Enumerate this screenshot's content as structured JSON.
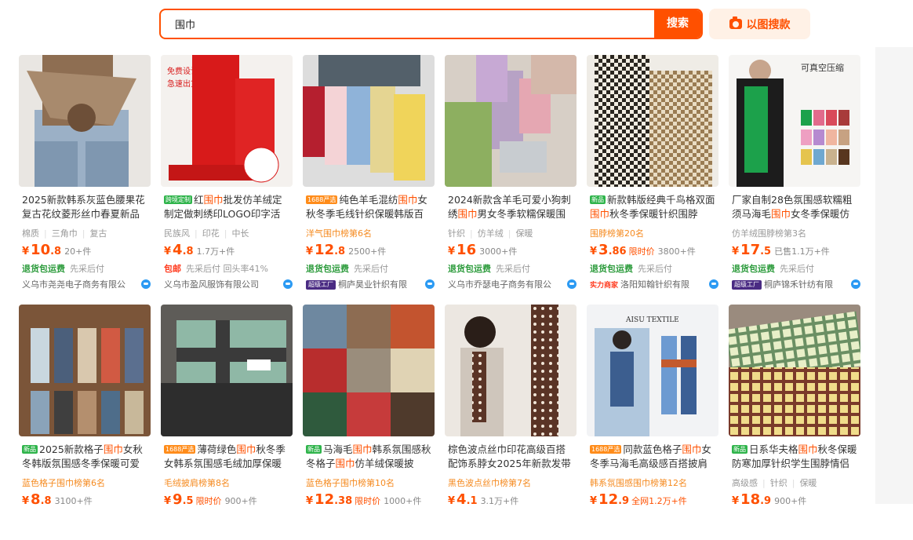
{
  "search": {
    "query": "围巾",
    "button": "搜索",
    "image_search": "以图搜款"
  },
  "colors": {
    "accent": "#ff5000"
  },
  "products": [
    {
      "id": 1,
      "title_pre": "",
      "title_hl": "",
      "title_post": "2025新款韩系灰蓝色腰果花复古花纹菱形丝巾春夏新品",
      "tags": [
        "棉质",
        "三角巾",
        "复古"
      ],
      "rank": "",
      "price_int": "10",
      "price_dec": ".8",
      "limited": "",
      "sold": "20+件",
      "service_a": "退货包运费",
      "service_a_type": "g",
      "service_b": "先采后付",
      "shop_badge": "",
      "shop": "义乌市尧尧电子商务有限公",
      "tag_label": "",
      "tag_type": ""
    },
    {
      "id": 2,
      "title_pre": "红",
      "title_hl": "围巾",
      "title_post": "批发仿羊绒定制定做刺绣印LOGO印字活",
      "tags": [
        "民族风",
        "印花",
        "中长"
      ],
      "rank": "",
      "price_int": "4",
      "price_dec": ".8",
      "limited": "",
      "sold": "1.7万+件",
      "service_a": "包邮",
      "service_a_type": "r",
      "service_b": "先采后付 回头率41%",
      "shop_badge": "",
      "shop": "义乌市盈风服饰有限公司",
      "tag_label": "跨境定制",
      "tag_type": "green"
    },
    {
      "id": 3,
      "title_pre": "纯色羊毛混纺",
      "title_hl": "围巾",
      "title_post": "女秋冬季毛线针织保暖韩版百",
      "tags": [],
      "rank": "洋气围巾榜第6名",
      "price_int": "12",
      "price_dec": ".8",
      "limited": "",
      "sold": "2500+件",
      "service_a": "退货包运费",
      "service_a_type": "g",
      "service_b": "先采后付",
      "shop_badge": "超级工厂",
      "shop": "桐庐昊业针织有限",
      "tag_label": "1688严选",
      "tag_type": "orange"
    },
    {
      "id": 4,
      "title_pre": "2024新款含羊毛可爱小狗刺绣",
      "title_hl": "围巾",
      "title_post": "男女冬季软糯保暖围",
      "tags": [
        "针织",
        "仿羊绒",
        "保暖"
      ],
      "rank": "",
      "price_int": "16",
      "price_dec": "",
      "limited": "",
      "sold": "3000+件",
      "service_a": "退货包运费",
      "service_a_type": "g",
      "service_b": "先采后付",
      "shop_badge": "",
      "shop": "义乌市乔瑟电子商务有限公",
      "tag_label": "",
      "tag_type": ""
    },
    {
      "id": 5,
      "title_pre": "新款韩版经典千鸟格双面",
      "title_hl": "围巾",
      "title_post": "秋冬季保暖针织围脖",
      "tags": [],
      "rank": "围脖榜第20名",
      "price_int": "3",
      "price_dec": ".86",
      "limited": "限时价",
      "sold": "3800+件",
      "service_a": "退货包运费",
      "service_a_type": "g",
      "service_b": "先采后付",
      "shop_badge": "实力商家",
      "shop": "洛阳知翰针织有限",
      "tag_label": "新品",
      "tag_type": "green"
    },
    {
      "id": 6,
      "title_pre": "厂家自制28色氛围感软糯粗须马海毛",
      "title_hl": "围巾",
      "title_post": "女冬季保暖仿",
      "tags": [
        "仿羊绒围脖榜第3名"
      ],
      "rank": "",
      "price_int": "17",
      "price_dec": ".5",
      "limited": "",
      "sold": "已售1.1万+件",
      "service_a": "退货包运费",
      "service_a_type": "g",
      "service_b": "先采后付",
      "shop_badge": "超级工厂",
      "shop": "桐庐锦禾针纺有限",
      "tag_label": "",
      "tag_type": ""
    },
    {
      "id": 7,
      "title_pre": "2025新款格子",
      "title_hl": "围巾",
      "title_post": "女秋冬韩版氛围感冬季保暖可爱百",
      "tags": [],
      "rank": "蓝色格子围巾榜第6名",
      "price_int": "8",
      "price_dec": ".8",
      "limited": "",
      "sold": "3100+件",
      "service_a": "",
      "service_a_type": "g",
      "service_b": "",
      "shop_badge": "",
      "shop": "",
      "tag_label": "新品",
      "tag_type": "green"
    },
    {
      "id": 8,
      "title_pre": "薄荷绿色",
      "title_hl": "围巾",
      "title_post": "秋冬季女韩系氛围感毛绒加厚保暖",
      "tags": [],
      "rank": "毛绒披肩榜第8名",
      "price_int": "9",
      "price_dec": ".5",
      "limited": "限时价",
      "sold": "900+件",
      "service_a": "",
      "service_a_type": "g",
      "service_b": "",
      "shop_badge": "",
      "shop": "",
      "tag_label": "1688严选",
      "tag_type": "orange"
    },
    {
      "id": 9,
      "title_pre": "马海毛",
      "title_hl": "围巾",
      "title_post": "韩系氛围感秋冬格子",
      "title_hl2": "围巾",
      "title_post2": "仿羊绒保暖披",
      "tags": [],
      "rank": "蓝色格子围巾榜第10名",
      "price_int": "12",
      "price_dec": ".38",
      "limited": "限时价",
      "sold": "1000+件",
      "service_a": "",
      "service_a_type": "g",
      "service_b": "",
      "shop_badge": "",
      "shop": "",
      "tag_label": "新品",
      "tag_type": "green"
    },
    {
      "id": 10,
      "title_pre": "棕色波点丝巾印花高级百搭配饰系脖女2025年新款发带",
      "title_hl": "",
      "title_post": "",
      "tags": [],
      "rank": "黑色波点丝巾榜第7名",
      "price_int": "4",
      "price_dec": ".1",
      "limited": "",
      "sold": "3.1万+件",
      "service_a": "",
      "service_a_type": "g",
      "service_b": "",
      "shop_badge": "",
      "shop": "",
      "tag_label": "",
      "tag_type": ""
    },
    {
      "id": 11,
      "title_pre": "同款蓝色格子",
      "title_hl": "围巾",
      "title_post": "女冬季马海毛高级感百搭披肩",
      "tags": [],
      "rank": "韩系氛围感围巾榜第12名",
      "price_int": "12",
      "price_dec": ".9",
      "limited": "全网1.2万+件",
      "sold": "",
      "service_a": "",
      "service_a_type": "g",
      "service_b": "",
      "shop_badge": "",
      "shop": "",
      "tag_label": "1688严选",
      "tag_type": "orange"
    },
    {
      "id": 12,
      "title_pre": "日系华夫格",
      "title_hl": "围巾",
      "title_post": "秋冬保暖防寒加厚针织学生围脖情侣高",
      "tags": [
        "高级感",
        "针织",
        "保暖"
      ],
      "rank": "",
      "price_int": "18",
      "price_dec": ".9",
      "limited": "",
      "sold": "900+件",
      "service_a": "",
      "service_a_type": "g",
      "service_b": "",
      "shop_badge": "",
      "shop": "",
      "tag_label": "新品",
      "tag_type": "green"
    }
  ]
}
